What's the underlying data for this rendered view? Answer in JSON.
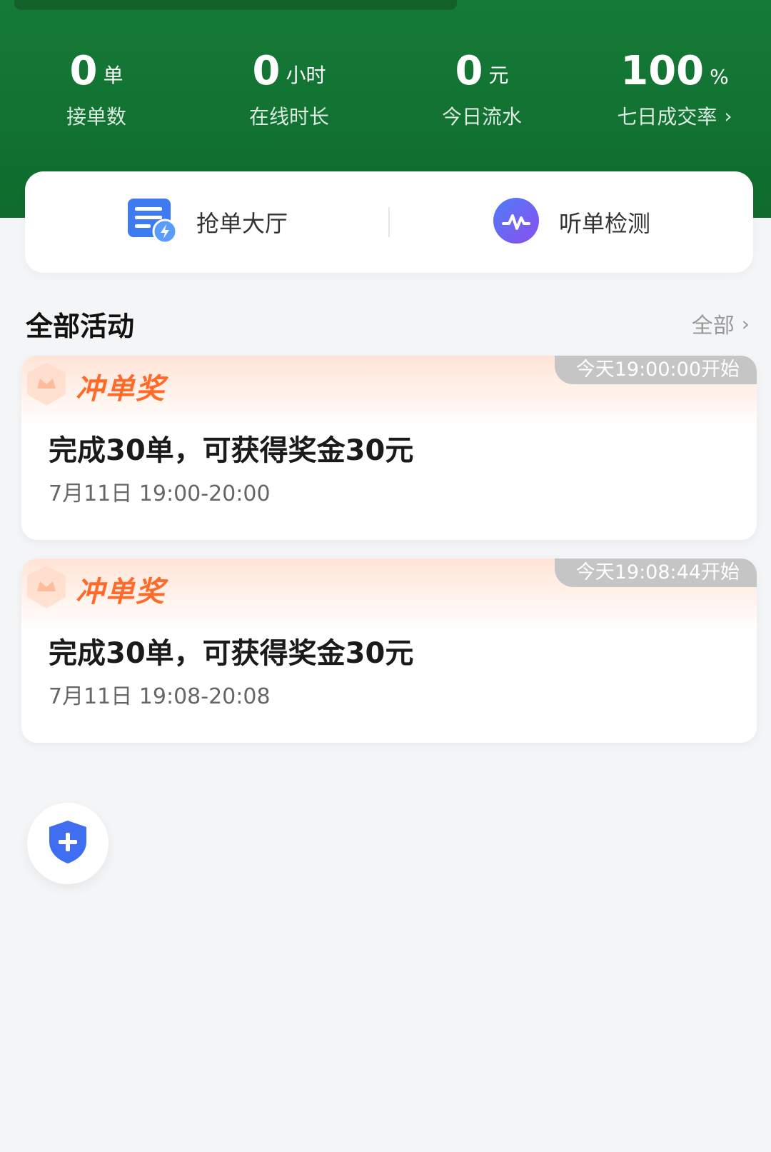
{
  "stats": [
    {
      "value": "0",
      "unit": "单",
      "label": "接单数"
    },
    {
      "value": "0",
      "unit": "小时",
      "label": "在线时长"
    },
    {
      "value": "0",
      "unit": "元",
      "label": "今日流水"
    },
    {
      "value": "100",
      "unit": "%",
      "label": "七日成交率",
      "chevron": "›"
    }
  ],
  "quick_actions": [
    {
      "label": "抢单大厅",
      "icon": "order-hall-icon"
    },
    {
      "label": "听单检测",
      "icon": "audio-check-icon"
    }
  ],
  "section": {
    "title": "全部活动",
    "more": "全部",
    "more_chevron": "›"
  },
  "events": [
    {
      "type": "冲单奖",
      "badge": "今天19:00:00开始",
      "title": "完成30单，可获得奖金30元",
      "time": "7月11日 19:00-20:00"
    },
    {
      "type": "冲单奖",
      "badge": "今天19:08:44开始",
      "title": "完成30单，可获得奖金30元",
      "time": "7月11日 19:08-20:08"
    }
  ],
  "fab": {
    "icon": "shield-plus-icon"
  },
  "colors": {
    "header_green": "#157a36",
    "accent_orange": "#ff6a2a",
    "badge_gray": "#c5c5c5",
    "icon_blue": "#3f7bf0",
    "icon_purple": "#6a5cf0"
  }
}
